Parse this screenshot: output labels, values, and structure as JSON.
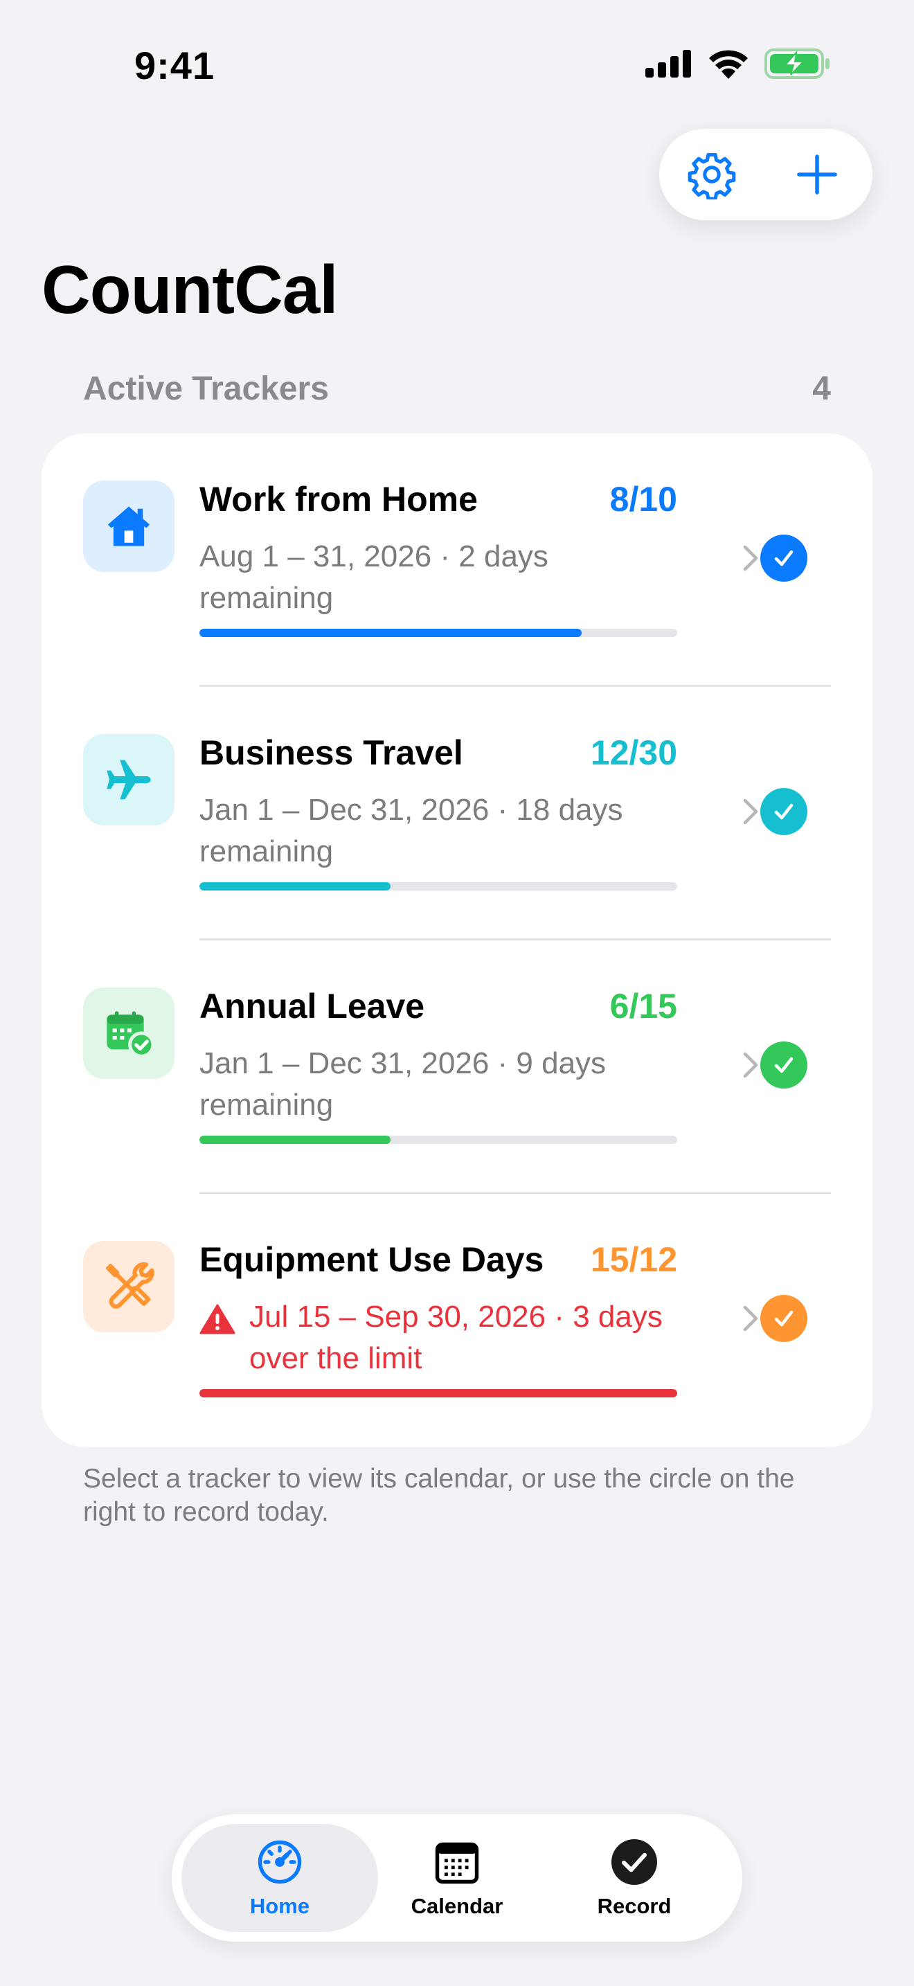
{
  "status_bar": {
    "time": "9:41"
  },
  "app": {
    "title": "CountCal"
  },
  "section": {
    "title": "Active Trackers",
    "count": "4"
  },
  "colors": {
    "blue": "#0a7aff",
    "teal": "#16bfcf",
    "green": "#34c759",
    "orange": "#ff9530",
    "red": "#e8323c"
  },
  "trackers": [
    {
      "name": "Work from Home",
      "count": "8/10",
      "subtitle": "Aug 1 – 31, 2026 · 2 days remaining",
      "progress": 0.8,
      "icon": "house-icon",
      "color": "#0a7aff",
      "tile_bg": "#ddeeff",
      "over_limit": false
    },
    {
      "name": "Business Travel",
      "count": "12/30",
      "subtitle": "Jan 1 – Dec 31, 2026 · 18 days remaining",
      "progress": 0.4,
      "icon": "airplane-icon",
      "color": "#16bfcf",
      "tile_bg": "#daf6f8",
      "over_limit": false
    },
    {
      "name": "Annual Leave",
      "count": "6/15",
      "subtitle": "Jan 1 – Dec 31, 2026 · 9 days remaining",
      "progress": 0.4,
      "icon": "calendar-check-icon",
      "color": "#34c759",
      "tile_bg": "#e0f6e6",
      "over_limit": false
    },
    {
      "name": "Equipment Use Days",
      "count": "15/12",
      "subtitle": "Jul 15 – Sep 30, 2026 · 3 days over the limit",
      "progress": 1.0,
      "icon": "tools-icon",
      "color": "#ff9530",
      "tile_bg": "#ffeadb",
      "over_limit": true
    }
  ],
  "footer": {
    "hint": "Select a tracker to view its calendar, or use the circle on the right to record today."
  },
  "tab_bar": {
    "items": [
      {
        "label": "Home",
        "icon": "gauge-icon",
        "active": true
      },
      {
        "label": "Calendar",
        "icon": "calendar-icon",
        "active": false
      },
      {
        "label": "Record",
        "icon": "checkmark-circle-icon",
        "active": false
      }
    ]
  }
}
